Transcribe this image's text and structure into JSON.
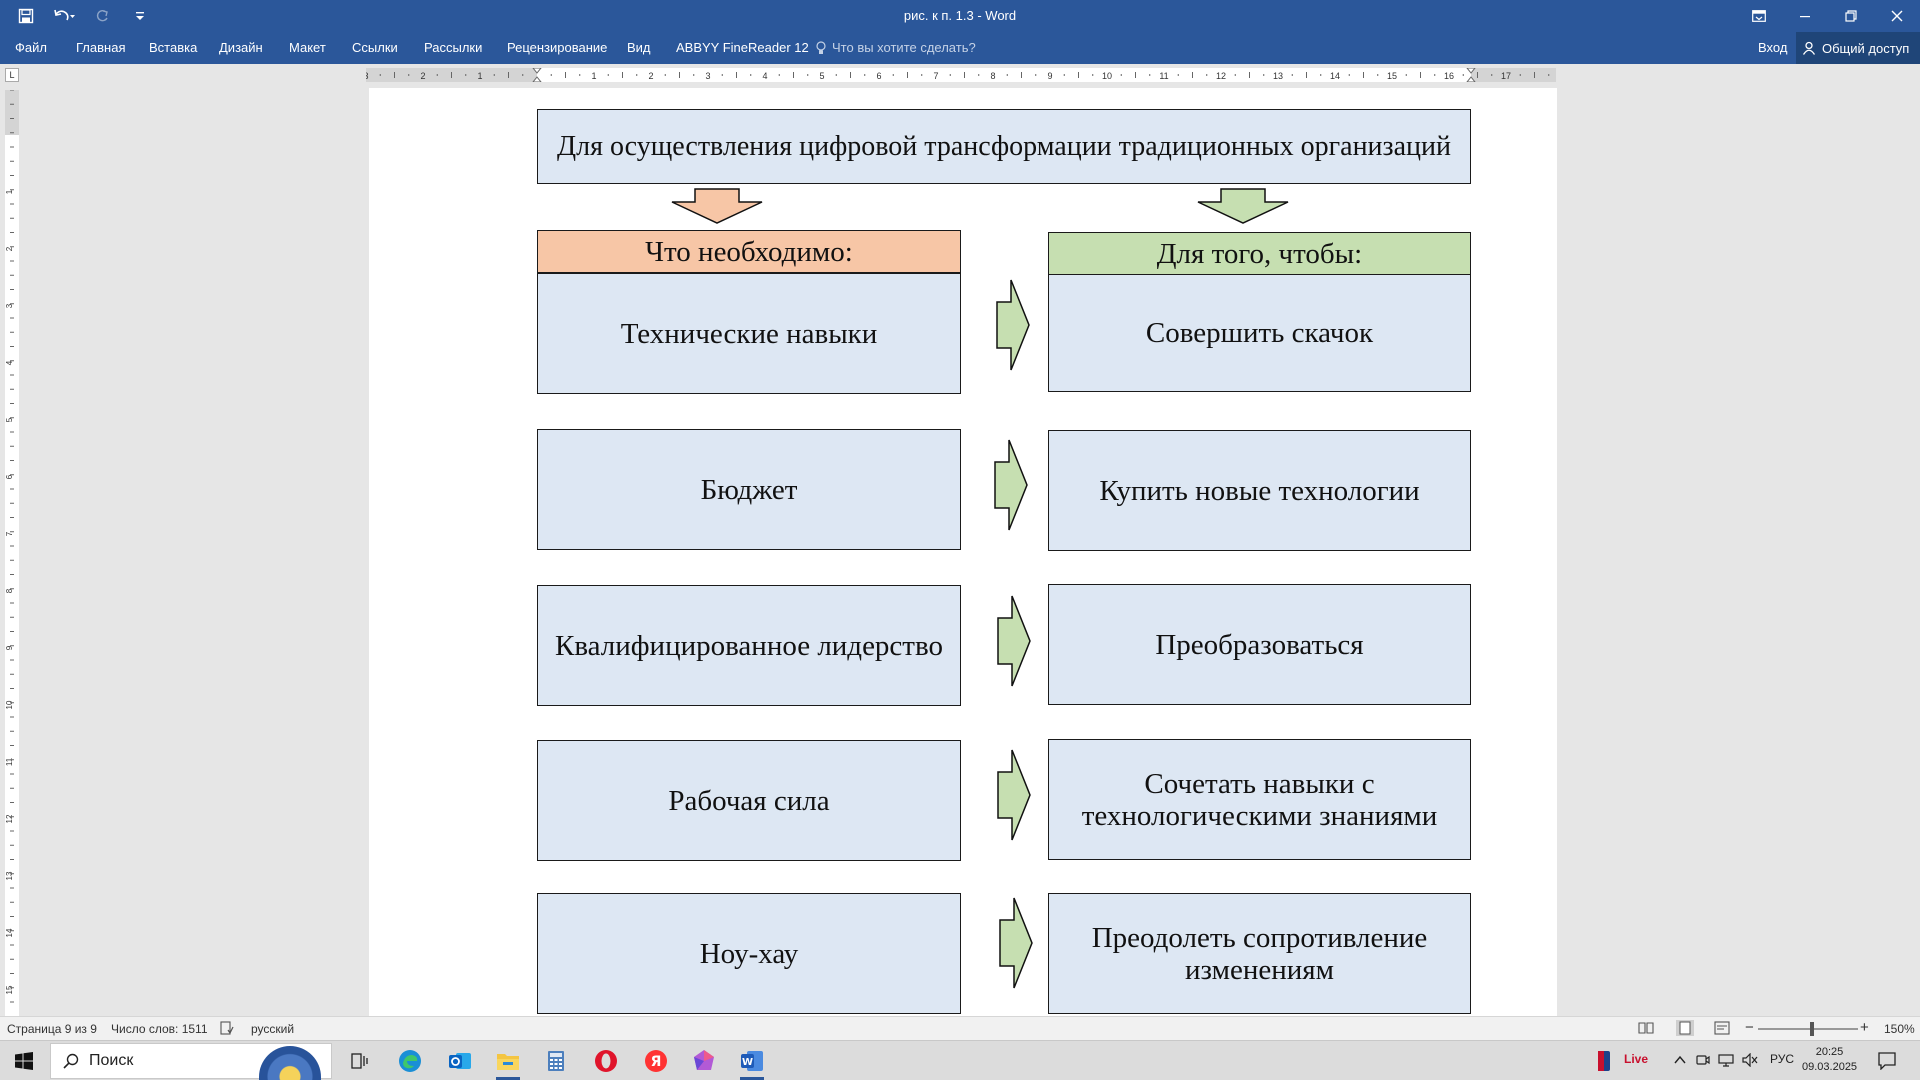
{
  "window": {
    "title": "рис. к п. 1.3 - Word",
    "controls": {
      "display_options_icon": "ribbon-display-icon",
      "minimize_icon": "minimize-icon",
      "restore_icon": "restore-icon",
      "close_icon": "close-icon"
    }
  },
  "quick_access": {
    "save_icon": "save-icon",
    "undo_icon": "undo-icon",
    "redo_icon": "redo-icon",
    "customize_icon": "customize-qat-icon"
  },
  "ribbon": {
    "tabs": [
      "Файл",
      "Главная",
      "Вставка",
      "Дизайн",
      "Макет",
      "Ссылки",
      "Рассылки",
      "Рецензирование",
      "Вид",
      "ABBYY FineReader 12"
    ],
    "tell_me_placeholder": "Что вы хотите сделать?",
    "sign_in": "Вход",
    "share": "Общий доступ"
  },
  "ruler": {
    "tab_selector": "L",
    "top_numbers": [
      "3",
      "2",
      "1",
      "1",
      "2",
      "3",
      "4",
      "5",
      "6",
      "7",
      "8",
      "9",
      "10",
      "11",
      "12",
      "13",
      "14",
      "15",
      "16",
      "17"
    ],
    "left_numbers": [
      "1",
      "1",
      "2",
      "3",
      "4",
      "5",
      "6",
      "7",
      "8",
      "9",
      "10",
      "11",
      "12",
      "13",
      "14",
      "15"
    ]
  },
  "diagram": {
    "title": "Для осуществления цифровой трансформации традиционных организаций",
    "left_header": "Что необходимо:",
    "right_header": "Для того, чтобы:",
    "rows": [
      {
        "need": "Технические навыки",
        "goal": "Совершить скачок"
      },
      {
        "need": "Бюджет",
        "goal": "Купить новые технологии"
      },
      {
        "need": "Квалифицированное лидерство",
        "goal": "Преобразоваться"
      },
      {
        "need": "Рабочая сила",
        "goal": "Сочетать навыки с технологическими знаниями"
      },
      {
        "need": "Ноу-хау",
        "goal": "Преодолеть сопротивление изменениям"
      }
    ],
    "colors": {
      "box_fill": "#dde7f3",
      "left_header_fill": "#f7c6a6",
      "right_header_fill": "#c6dfb1",
      "left_arrow_fill": "#f7c6a6",
      "right_arrow_fill": "#c6dfb1"
    }
  },
  "status": {
    "page": "Страница 9 из 9",
    "words": "Число слов: 1511",
    "language": "русский",
    "zoom": "150%",
    "zoom_level_percent": 150
  },
  "taskbar": {
    "search_label": "Поиск",
    "apps": [
      "task-view-icon",
      "edge-icon",
      "outlook-icon",
      "file-explorer-icon",
      "calculator-icon",
      "opera-icon",
      "yandex-icon",
      "app-icon",
      "word-icon"
    ],
    "tray": {
      "live": "Live",
      "language": "РУС"
    },
    "clock": {
      "time": "20:25",
      "date": "09.03.2025"
    }
  }
}
